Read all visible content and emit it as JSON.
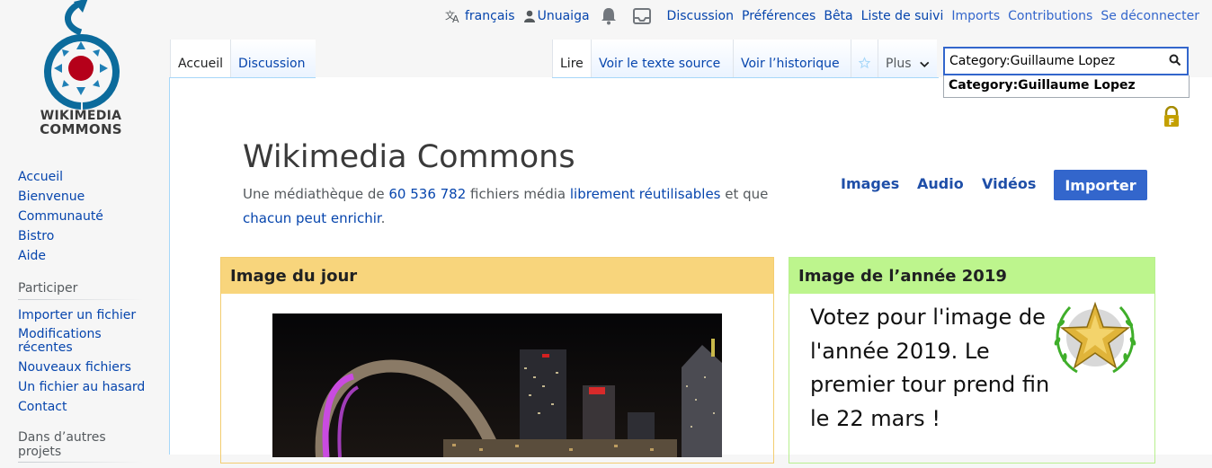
{
  "logo": {
    "line1": "WIKIMEDIA",
    "line2": "COMMONS"
  },
  "personal_tools": {
    "language": "français",
    "user": "Unuaiga",
    "links": [
      "Discussion",
      "Préférences",
      "Bêta",
      "Liste de suivi",
      "Imports",
      "Contributions",
      "Se déconnecter"
    ]
  },
  "tabs": {
    "accueil": "Accueil",
    "discussion": "Discussion",
    "lire": "Lire",
    "source": "Voir le texte source",
    "history": "Voir l’historique",
    "plus": "Plus"
  },
  "search": {
    "value": "Category:Guillaume Lopez",
    "suggestion": "Category:Guillaume Lopez"
  },
  "sidebar": {
    "nav": [
      "Accueil",
      "Bienvenue",
      "Communauté",
      "Bistro",
      "Aide"
    ],
    "participate_heading": "Participer",
    "participate": [
      "Importer un fichier",
      "Modifications récentes",
      "Nouveaux fichiers",
      "Un fichier au hasard",
      "Contact"
    ],
    "other_heading": "Dans d’autres projets"
  },
  "main": {
    "title": "Wikimedia Commons",
    "tagline_1": "Une médiathèque de ",
    "tagline_count": "60 536 782",
    "tagline_2": " fichiers média ",
    "tagline_link": "librement réutilisables",
    "tagline_3": " et que ",
    "tagline_link2": "chacun peut enrichir",
    "tagline_4": ".",
    "nav": {
      "images": "Images",
      "audio": "Audio",
      "videos": "Vidéos"
    },
    "import_button": "Importer"
  },
  "potd": {
    "heading": "Image du jour"
  },
  "poty": {
    "heading": "Image de l’année 2019",
    "text": "Votez pour l'image de l'année 2019. Le premier tour prend fin le 22 mars !"
  },
  "colors": {
    "link": "#0645ad",
    "import_button": "#3366cc",
    "potd_header": "#f8d57c",
    "poty_header": "#bdf58d"
  }
}
